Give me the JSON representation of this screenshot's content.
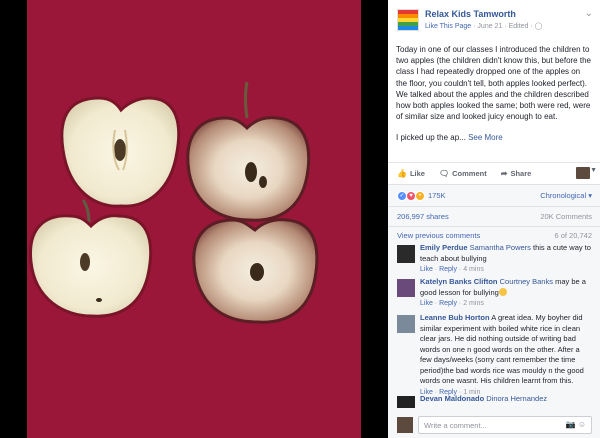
{
  "post": {
    "page_name": "Relax Kids Tamworth",
    "like_page": "Like This Page",
    "date": "June 21",
    "edited": "Edited",
    "paragraph1": "Today in one of our classes I introduced the children to two apples (the children didn't know this, but before the class I had repeatedly dropped one of the apples on the floor, you couldn't tell, both apples looked perfect). We talked about the apples and the children described how both apples looked the same; both were red, were of similar size and looked juicy enough to eat.",
    "paragraph2": "I picked up the ap...",
    "see_more": "See More",
    "logo_colors": [
      "#e53935",
      "#fb8c00",
      "#fdd835",
      "#43a047",
      "#1e88e5"
    ]
  },
  "actions": {
    "like": "Like",
    "comment": "Comment",
    "share": "Share"
  },
  "stats": {
    "reactions": "175K",
    "sort": "Chronological",
    "shares": "206,997 shares",
    "comments_count": "20K Comments"
  },
  "comments": {
    "view_previous": "View previous comments",
    "position": "6 of 20,742",
    "reply": "Reply",
    "like": "Like",
    "items": [
      {
        "name": "Emily Perdue",
        "tag": "Samantha Powers",
        "text": "this a cute way to teach about bullying",
        "time": "4 mins"
      },
      {
        "name": "Katelyn Banks Clifton",
        "tag": "Courtney Banks",
        "text": "may be a good lesson for bullying",
        "time": "2 mins"
      },
      {
        "name": "Leanne Bub Horton",
        "tag": "",
        "text": "A great idea. My boyher did similar experiment with boiled white rice in clean clear jars. He did nothing outside of writing bad words on one n good words on the other. After a few days/weeks (sorry cant remember the time period)the bad words rice was mouldy n the good words one wasnt. His children learnt from this.",
        "time": "1 min"
      },
      {
        "name": "Devan Maldonado",
        "tag": "Dinora Hernandez",
        "text": "",
        "time": ""
      }
    ],
    "write_placeholder": "Write a comment..."
  }
}
